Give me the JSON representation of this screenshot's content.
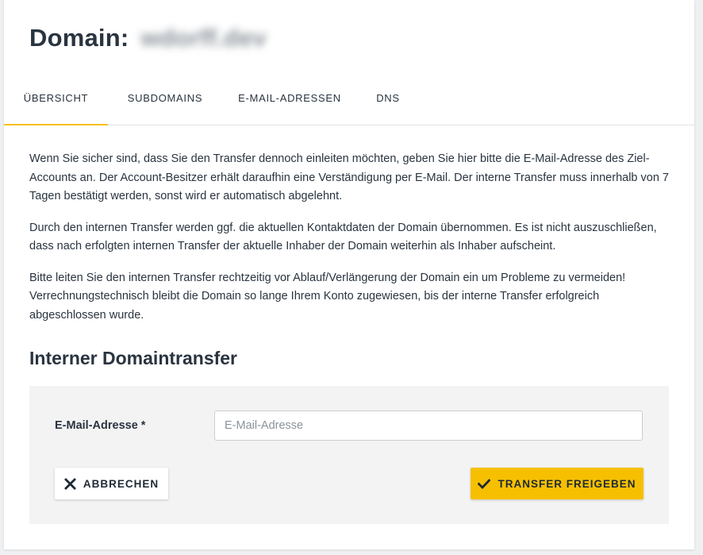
{
  "header": {
    "title_prefix": "Domain:",
    "domain": "wdorff.dev"
  },
  "tabs": [
    {
      "label": "ÜBERSICHT",
      "active": true
    },
    {
      "label": "SUBDOMAINS",
      "active": false
    },
    {
      "label": "E-MAIL-ADRESSEN",
      "active": false
    },
    {
      "label": "DNS",
      "active": false
    }
  ],
  "content": {
    "paragraphs": [
      "Wenn Sie sicher sind, dass Sie den Transfer dennoch einleiten möchten, geben Sie hier bitte die E-Mail-Adresse des Ziel-Accounts an. Der Account-Besitzer erhält daraufhin eine Verständigung per E-Mail. Der interne Transfer muss innerhalb von 7 Tagen bestätigt werden, sonst wird er automatisch abgelehnt.",
      "Durch den internen Transfer werden ggf. die aktuellen Kontaktdaten der Domain übernommen. Es ist nicht auszuschließen, dass nach erfolgten internen Transfer der aktuelle Inhaber der Domain weiterhin als Inhaber aufscheint.",
      "Bitte leiten Sie den internen Transfer rechtzeitig vor Ablauf/Verlängerung der Domain ein um Probleme zu vermeiden! Verrechnungstechnisch bleibt die Domain so lange Ihrem Konto zugewiesen, bis der interne Transfer erfolgreich abgeschlossen wurde."
    ]
  },
  "form": {
    "section_title": "Interner Domaintransfer",
    "email_label": "E-Mail-Adresse *",
    "email_placeholder": "E-Mail-Adresse",
    "email_value": "",
    "cancel_label": "ABBRECHEN",
    "submit_label": "TRANSFER FREIGEBEN"
  },
  "icons": {
    "cancel": "close-icon",
    "submit": "check-icon"
  },
  "colors": {
    "accent": "#f6c000",
    "text": "#2a3440",
    "panel": "#f3f3f3"
  }
}
